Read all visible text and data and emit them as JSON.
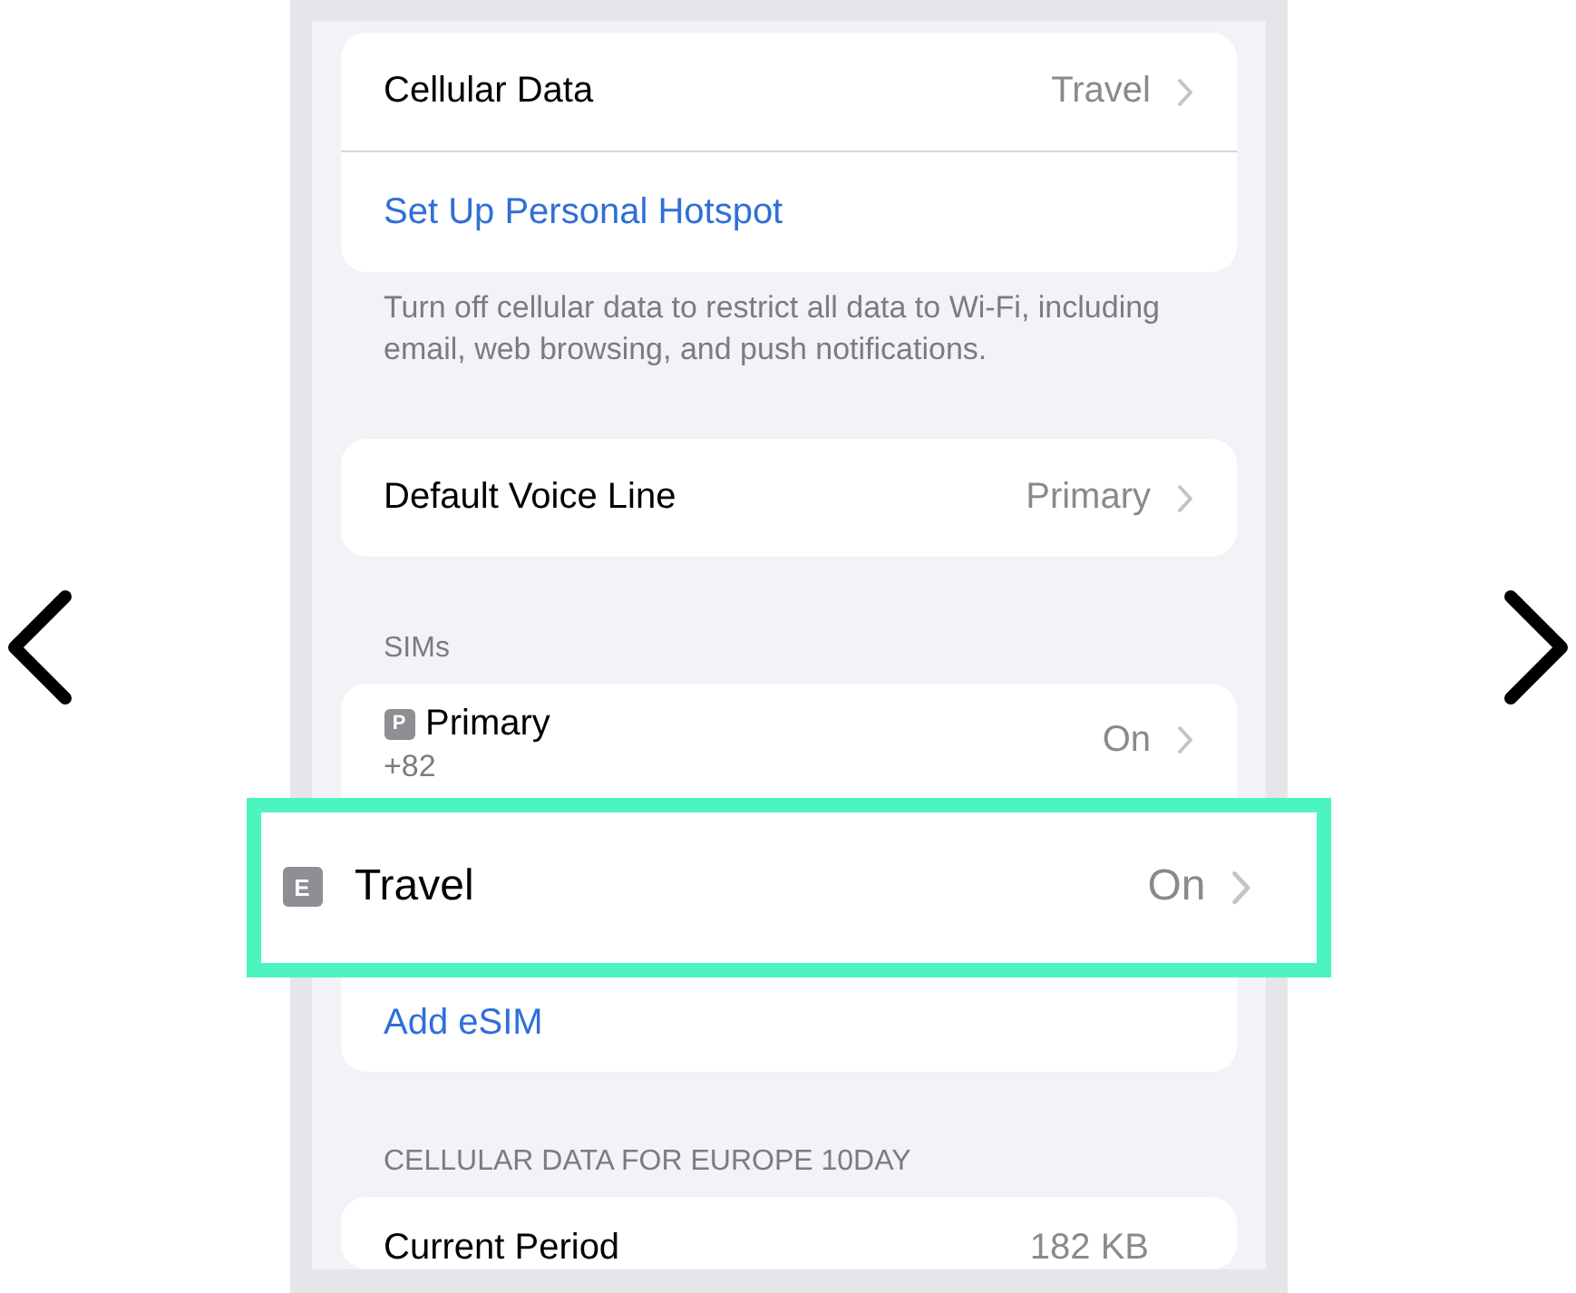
{
  "cellular_data": {
    "label": "Cellular Data",
    "value": "Travel",
    "hotspot_link": "Set Up Personal Hotspot",
    "footer": "Turn off cellular data to restrict all data to Wi-Fi, including email, web browsing, and push notifications."
  },
  "voice": {
    "label": "Default Voice Line",
    "value": "Primary"
  },
  "sims": {
    "header": "SIMs",
    "items": [
      {
        "badge": "P",
        "name": "Primary",
        "number": "+82",
        "status": "On",
        "highlighted": false
      },
      {
        "badge": "E",
        "name": "Travel",
        "status": "On",
        "highlighted": true
      }
    ],
    "add_link": "Add eSIM"
  },
  "usage": {
    "header": "CELLULAR DATA FOR EUROPE 10DAY",
    "rows": [
      {
        "label": "Current Period",
        "value": "182 KB"
      }
    ]
  }
}
